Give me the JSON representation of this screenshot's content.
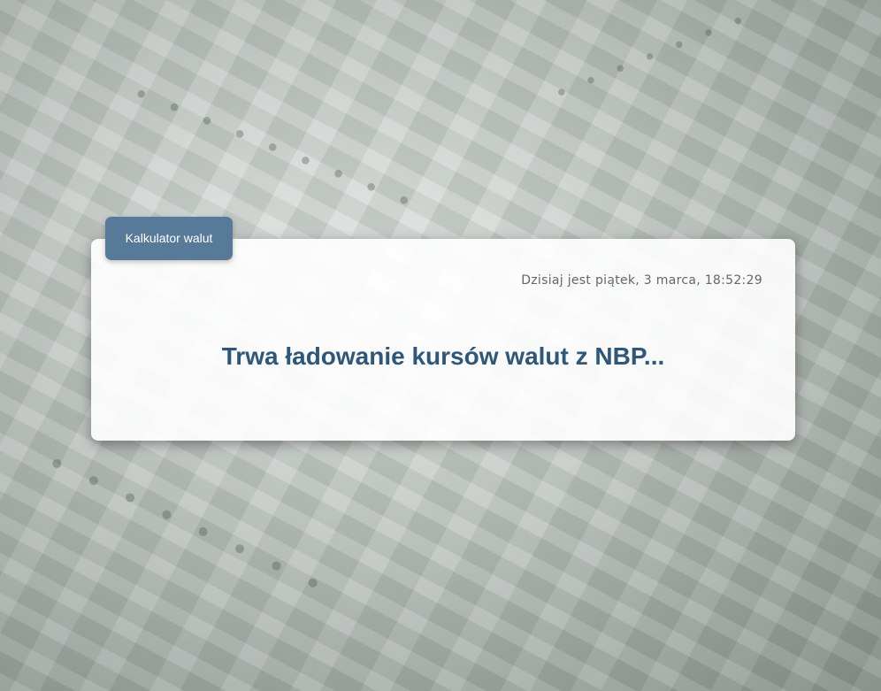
{
  "app": {
    "tab_label": "Kalkulator walut"
  },
  "status": {
    "date_text": "Dzisiaj jest piątek, 3 marca, 18:52:29",
    "loading_message": "Trwa ładowanie kursów walut z NBP..."
  },
  "colors": {
    "accent": "#577a99",
    "heading": "#2e5779",
    "card_background": "#ffffff"
  }
}
